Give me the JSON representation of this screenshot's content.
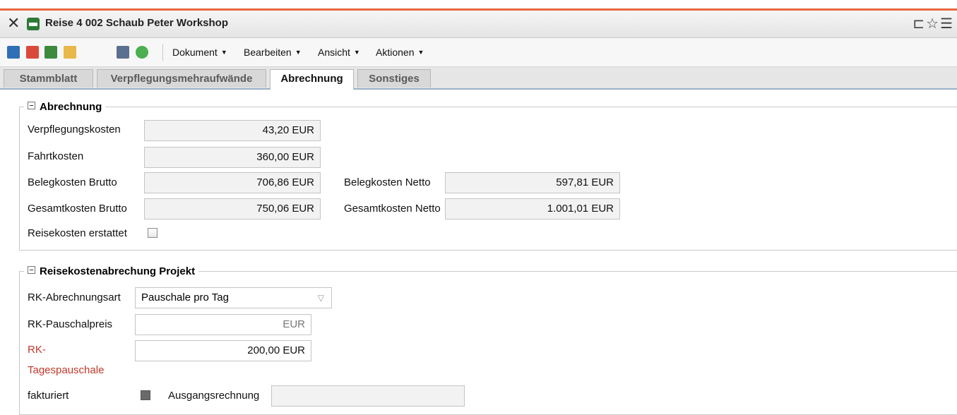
{
  "window": {
    "title": "Reise 4 002 Schaub Peter Workshop",
    "close_icon": "close-icon",
    "right_icons": "⊏☆☰"
  },
  "toolbar": {
    "icons": [
      "save-icon",
      "delete-icon",
      "download-icon",
      "folder-icon",
      "print-icon",
      "check-icon"
    ],
    "menus": [
      "Dokument",
      "Bearbeiten",
      "Ansicht",
      "Aktionen"
    ]
  },
  "tabs": [
    {
      "label": "Stammblatt",
      "active": false
    },
    {
      "label": "Verpflegungsmehraufwände",
      "active": false
    },
    {
      "label": "Abrechnung",
      "active": true
    },
    {
      "label": "Sonstiges",
      "active": false
    }
  ],
  "abrechnung": {
    "legend": "Abrechnung",
    "verpflegungskosten_label": "Verpflegungskosten",
    "verpflegungskosten_value": "43,20 EUR",
    "fahrtkosten_label": "Fahrtkosten",
    "fahrtkosten_value": "360,00 EUR",
    "belegkosten_brutto_label": "Belegkosten Brutto",
    "belegkosten_brutto_value": "706,86 EUR",
    "belegkosten_netto_label": "Belegkosten Netto",
    "belegkosten_netto_value": "597,81 EUR",
    "gesamtkosten_brutto_label": "Gesamtkosten Brutto",
    "gesamtkosten_brutto_value": "750,06 EUR",
    "gesamtkosten_netto_label": "Gesamtkosten Netto",
    "gesamtkosten_netto_value": "1.001,01 EUR",
    "erstattet_label": "Reisekosten erstattet",
    "erstattet_checked": false
  },
  "projekt": {
    "legend": "Reisekostenabrechung Projekt",
    "art_label": "RK-Abrechnungsart",
    "art_value": "Pauschale pro Tag",
    "pauschalpreis_label": "RK-Pauschalpreis",
    "pauschalpreis_value": "EUR",
    "tagespauschale_label_1": "RK-",
    "tagespauschale_label_2": "Tagespauschale",
    "tagespauschale_value": "200,00 EUR",
    "fakturiert_label": "fakturiert",
    "ausgangsrechnung_label": "Ausgangsrechnung",
    "ausgangsrechnung_value": ""
  },
  "colors": {
    "accent_top": "#e8683f",
    "required_label": "#c0392b"
  }
}
